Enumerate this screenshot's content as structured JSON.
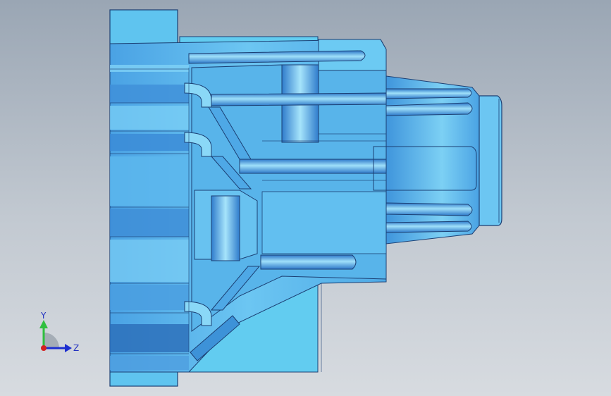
{
  "viewport": {
    "background_top": "#9aa6b4",
    "background_bottom": "#d7dbe0"
  },
  "model": {
    "primary_color": "#5fb6ec",
    "light_color": "#8fd6f6",
    "dark_color": "#2b74c4",
    "edge_color": "#1b3f73"
  },
  "triad": {
    "y_label": "Y",
    "z_label": "Z",
    "y_color": "#2fbf3f",
    "z_color": "#1d2fd0",
    "x_color": "#d42020"
  }
}
